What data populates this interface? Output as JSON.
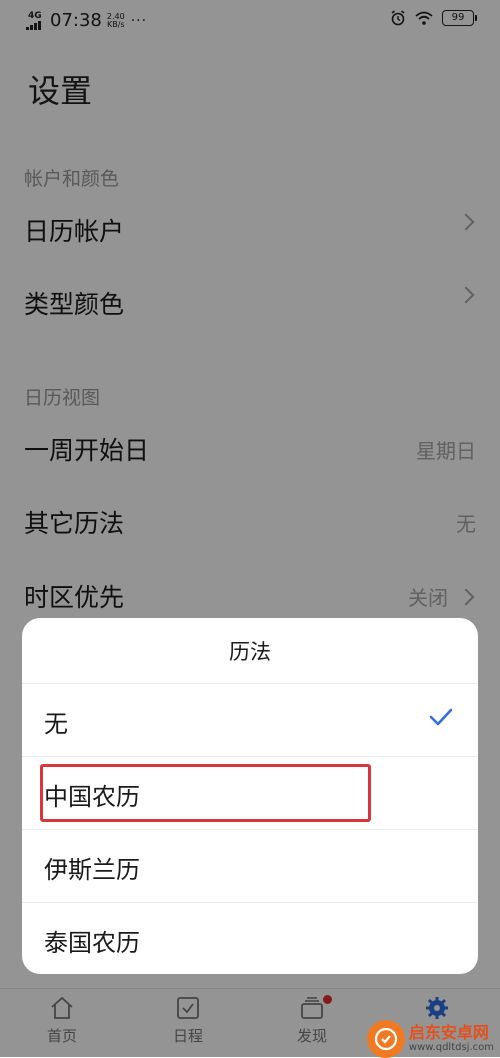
{
  "status_bar": {
    "network": "4G",
    "time": "07:38",
    "speed_value": "2.40",
    "speed_unit": "KB/s",
    "more": "···",
    "battery": "99"
  },
  "page_title": "设置",
  "sections": [
    {
      "label": "帐户和颜色"
    },
    {
      "label": "日历视图"
    }
  ],
  "rows": [
    {
      "label": "日历帐户",
      "value": ""
    },
    {
      "label": "类型颜色",
      "value": ""
    },
    {
      "label": "一周开始日",
      "value": "星期日"
    },
    {
      "label": "其它历法",
      "value": "无"
    },
    {
      "label": "时区优先",
      "value": "关闭"
    }
  ],
  "bottom_nav": [
    {
      "label": "首页",
      "icon": "home-icon"
    },
    {
      "label": "日程",
      "icon": "schedule-icon"
    },
    {
      "label": "发现",
      "icon": "discover-icon"
    },
    {
      "label": "",
      "icon": "settings-icon"
    }
  ],
  "sheet": {
    "title": "历法",
    "options": [
      {
        "label": "无",
        "selected": true
      },
      {
        "label": "中国农历",
        "selected": false,
        "highlighted": true
      },
      {
        "label": "伊斯兰历",
        "selected": false
      },
      {
        "label": "泰国农历",
        "selected": false
      }
    ]
  },
  "watermark": {
    "name": "启东安卓网",
    "url": "www.qdltdsj.com"
  },
  "colors": {
    "accent": "#2f6fe0",
    "highlight_box": "#d8363c",
    "overlay": "rgba(0,0,0,0.42)"
  }
}
